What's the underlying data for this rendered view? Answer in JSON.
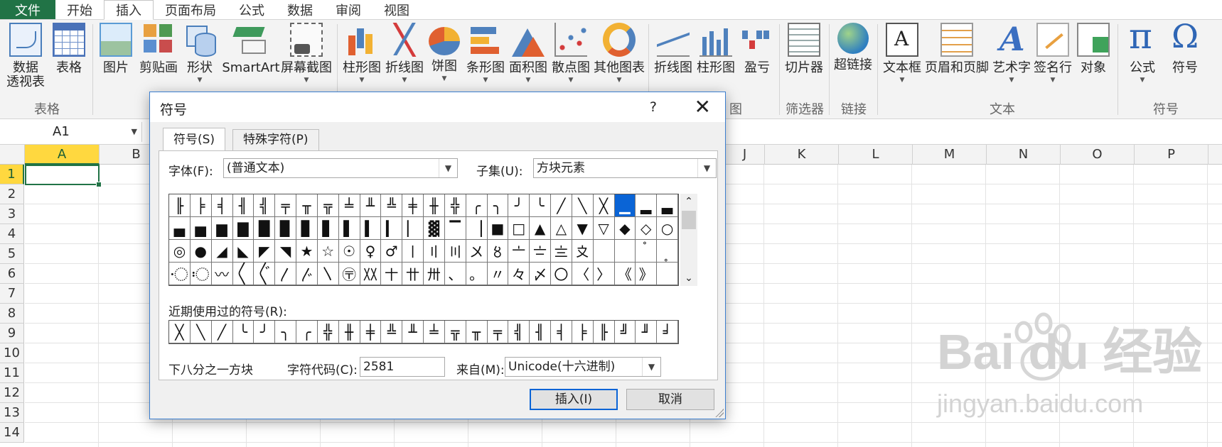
{
  "menu": {
    "file": "文件",
    "tabs": [
      "开始",
      "插入",
      "页面布局",
      "公式",
      "数据",
      "审阅",
      "视图"
    ],
    "active": "插入"
  },
  "ribbon": {
    "buttons": {
      "pivot_line1": "数据",
      "pivot_line2": "透视表",
      "table": "表格",
      "picture": "图片",
      "clipart": "剪贴画",
      "shapes": "形状",
      "smartart": "SmartArt",
      "screenshot": "屏幕截图",
      "column_chart": "柱形图",
      "line_chart": "折线图",
      "pie_chart": "饼图",
      "bar_chart": "条形图",
      "area_chart": "面积图",
      "scatter_chart": "散点图",
      "other_chart": "其他图表",
      "spark_line": "折线图",
      "spark_column": "柱形图",
      "spark_winloss": "盈亏",
      "slicer": "切片器",
      "hyperlink": "超链接",
      "textbox": "文本框",
      "header_footer": "页眉和页脚",
      "wordart": "艺术字",
      "signature": "签名行",
      "object": "对象",
      "equation": "公式",
      "symbol": "符号"
    },
    "groups": {
      "tables": "表格",
      "charts_partial": "图",
      "filter": "筛选器",
      "links": "链接",
      "text": "文本",
      "symbols": "符号"
    }
  },
  "formula_bar": {
    "name_box": "A1"
  },
  "grid": {
    "columns": [
      "A",
      "B",
      "J",
      "K",
      "L",
      "M",
      "N",
      "O",
      "P"
    ],
    "rows": [
      "1",
      "2",
      "3",
      "4",
      "5",
      "6",
      "7",
      "8",
      "9",
      "10",
      "11",
      "12",
      "13",
      "14"
    ],
    "selected_cell": "A1"
  },
  "dialog": {
    "title": "符号",
    "help": "?",
    "close": "✕",
    "tabs": [
      "符号(S)",
      "特殊字符(P)"
    ],
    "font_label": "字体(F):",
    "font_value": "(普通文本)",
    "subset_label": "子集(U):",
    "subset_value": "方块元素",
    "symbols": [
      "╟",
      "╞",
      "╡",
      "╢",
      "╣",
      "╤",
      "╥",
      "╦",
      "╧",
      "╨",
      "╩",
      "╪",
      "╫",
      "╬",
      "╭",
      "╮",
      "╯",
      "╰",
      "╱",
      "╲",
      "╳",
      "▁",
      "▂",
      "▃",
      "▄",
      "▅",
      "▆",
      "▇",
      "█",
      "▉",
      "▊",
      "▋",
      "▌",
      "▍",
      "▎",
      "▏",
      "▓",
      "▔",
      "▕",
      "■",
      "□",
      "▲",
      "△",
      "▼",
      "▽",
      "◆",
      "◇",
      "○",
      "◎",
      "●",
      "◢",
      "◣",
      "◤",
      "◥",
      "★",
      "☆",
      "☉",
      "♀",
      "♂",
      "〡",
      "〢",
      "〣",
      "〤",
      "〥",
      "〦",
      "〧",
      "〨",
      "〩",
      "〪",
      "〫",
      "〬",
      "〭",
      "〮",
      "〯",
      "〰",
      "〱",
      "〲",
      "〳",
      "〴",
      "〵",
      "〶",
      "〷",
      "〸",
      "〹",
      "〺",
      "、",
      "。",
      "〃",
      "々",
      "〆",
      "〇",
      "〈",
      "〉",
      "《",
      "》",
      " "
    ],
    "selected_symbol": "▁",
    "recent_label": "近期使用过的符号(R):",
    "recent": [
      "╳",
      "╲",
      "╱",
      "╰",
      "╯",
      "╮",
      "╭",
      "╬",
      "╫",
      "╪",
      "╩",
      "╨",
      "╧",
      "╦",
      "╥",
      "╤",
      "╣",
      "╢",
      "╡",
      "╞",
      "╟",
      "╝",
      "╜",
      "╛"
    ],
    "symbol_name": "下八分之一方块",
    "charcode_label": "字符代码(C):",
    "charcode_value": "2581",
    "from_label": "来自(M):",
    "from_value": "Unicode(十六进制)",
    "insert_button": "插入(I)",
    "cancel_button": "取消"
  },
  "watermark": {
    "line1": "Bai  du 经验",
    "line2": "jingyan.baidu.com"
  }
}
